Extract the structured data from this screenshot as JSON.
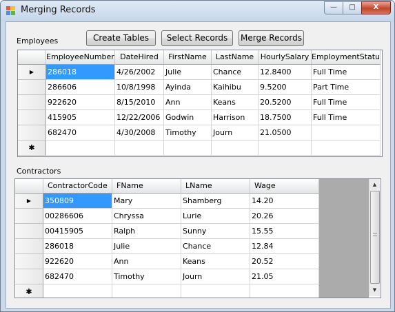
{
  "window": {
    "title": "Merging Records",
    "minimize": "—",
    "maximize": "□",
    "close": "X"
  },
  "buttons": {
    "create": "Create Tables",
    "select": "Select Records",
    "merge": "Merge Records"
  },
  "employees": {
    "label": "Employees",
    "columns": [
      "EmployeeNumber",
      "DateHired",
      "FirstName",
      "LastName",
      "HourlySalary",
      "EmploymentStatus"
    ],
    "rows": [
      [
        "286018",
        "4/26/2002",
        "Julie",
        "Chance",
        "12.8400",
        "Full Time"
      ],
      [
        "286606",
        "10/8/1998",
        "Ayinda",
        "Kaihibu",
        "9.5200",
        "Part Time"
      ],
      [
        "922620",
        "8/15/2010",
        "Ann",
        "Keans",
        "20.5200",
        "Full Time"
      ],
      [
        "415905",
        "12/22/2006",
        "Godwin",
        "Harrison",
        "18.7500",
        "Full Time"
      ],
      [
        "682470",
        "4/30/2008",
        "Timothy",
        "Journ",
        "21.0500",
        ""
      ]
    ],
    "current_marker": "▶",
    "new_row_marker": "✱"
  },
  "contractors": {
    "label": "Contractors",
    "columns": [
      "ContractorCode",
      "FName",
      "LName",
      "Wage"
    ],
    "rows": [
      [
        "350809",
        "Mary",
        "Shamberg",
        "14.20"
      ],
      [
        "00286606",
        "Chryssa",
        "Lurie",
        "20.26"
      ],
      [
        "00415905",
        "Ralph",
        "Sunny",
        "15.55"
      ],
      [
        "286018",
        "Julie",
        "Chance",
        "12.84"
      ],
      [
        "922620",
        "Ann",
        "Keans",
        "20.52"
      ],
      [
        "682470",
        "Timothy",
        "Journ",
        "21.05"
      ]
    ],
    "current_marker": "▶",
    "new_row_marker": "✱",
    "scroll_up": "▲",
    "scroll_down": "▼"
  },
  "colors": {
    "selection": "#3399ff",
    "window_frame": "#cdd9e8",
    "client": "#f0f0f0",
    "grid_empty": "#ababab"
  }
}
